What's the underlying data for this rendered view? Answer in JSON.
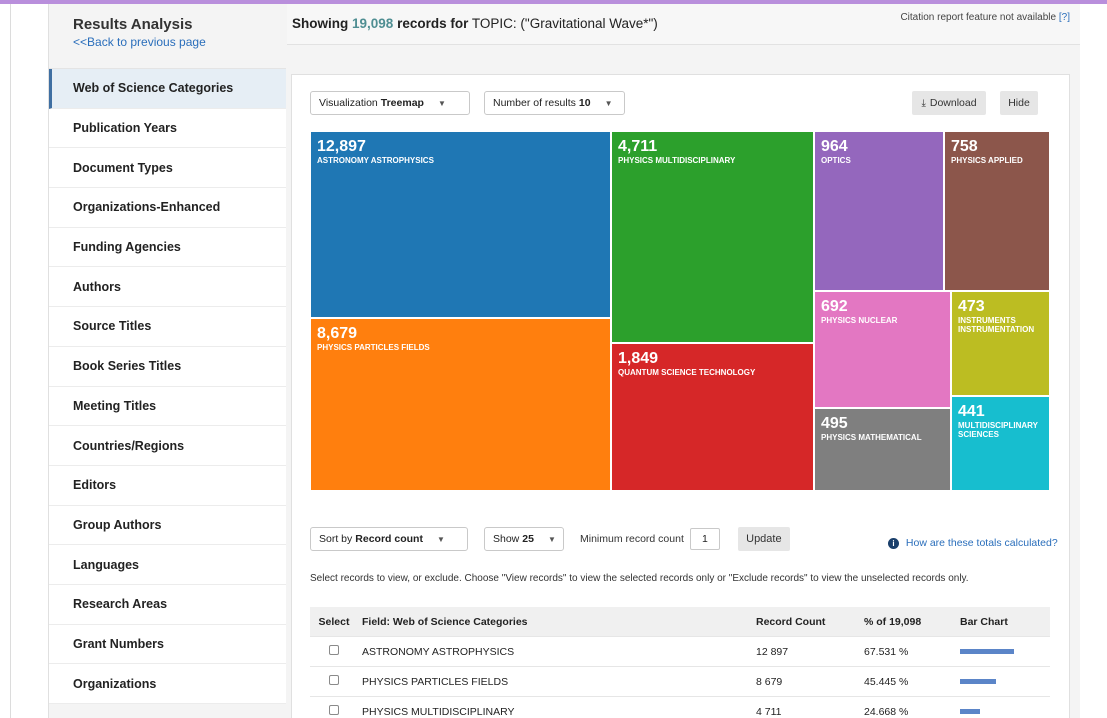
{
  "sidebar": {
    "title": "Results Analysis",
    "back_link": "<<Back to previous page",
    "items": [
      {
        "label": "Web of Science Categories",
        "active": true
      },
      {
        "label": "Publication Years"
      },
      {
        "label": "Document Types"
      },
      {
        "label": "Organizations-Enhanced"
      },
      {
        "label": "Funding Agencies"
      },
      {
        "label": "Authors"
      },
      {
        "label": "Source Titles"
      },
      {
        "label": "Book Series Titles"
      },
      {
        "label": "Meeting Titles"
      },
      {
        "label": "Countries/Regions"
      },
      {
        "label": "Editors"
      },
      {
        "label": "Group Authors"
      },
      {
        "label": "Languages"
      },
      {
        "label": "Research Areas"
      },
      {
        "label": "Grant Numbers"
      },
      {
        "label": "Organizations"
      }
    ]
  },
  "header": {
    "showing_prefix": "Showing",
    "count": "19,098",
    "records_for": "records for",
    "topic_label": "TOPIC:",
    "query": "(\"Gravitational Wave*\")",
    "citation_note": "Citation report feature not available",
    "citation_help": "[?]"
  },
  "controls": {
    "viz_label": "Visualization",
    "viz_value": "Treemap",
    "results_label": "Number of results",
    "results_value": "10",
    "download_label": "Download",
    "hide_label": "Hide"
  },
  "treemap": [
    {
      "count": "12,897",
      "label": "ASTRONOMY ASTROPHYSICS",
      "color": "#1f77b4"
    },
    {
      "count": "8,679",
      "label": "PHYSICS PARTICLES FIELDS",
      "color": "#ff7f0e"
    },
    {
      "count": "4,711",
      "label": "PHYSICS MULTIDISCIPLINARY",
      "color": "#2ca02c"
    },
    {
      "count": "1,849",
      "label": "QUANTUM SCIENCE TECHNOLOGY",
      "color": "#d62728"
    },
    {
      "count": "964",
      "label": "OPTICS",
      "color": "#9467bd"
    },
    {
      "count": "758",
      "label": "PHYSICS APPLIED",
      "color": "#8c564b"
    },
    {
      "count": "692",
      "label": "PHYSICS NUCLEAR",
      "color": "#e377c2"
    },
    {
      "count": "473",
      "label": "INSTRUMENTS INSTRUMENTATION",
      "color": "#bcbd22"
    },
    {
      "count": "495",
      "label": "PHYSICS MATHEMATICAL",
      "color": "#7f7f7f"
    },
    {
      "count": "441",
      "label": "MULTIDISCIPLINARY SCIENCES",
      "color": "#17becf"
    }
  ],
  "controls2": {
    "sort_label": "Sort by",
    "sort_value": "Record count",
    "show_label": "Show",
    "show_value": "25",
    "min_label": "Minimum record count",
    "min_value": "1",
    "update_label": "Update",
    "how_link": "How are these totals calculated?"
  },
  "instructions": "Select records to view, or exclude. Choose \"View records\" to view the selected records only or \"Exclude records\" to view the unselected records only.",
  "table": {
    "headers": {
      "select": "Select",
      "field": "Field: Web of Science Categories",
      "count": "Record Count",
      "pct": "% of 19,098",
      "bar": "Bar Chart"
    },
    "rows": [
      {
        "field": "ASTRONOMY ASTROPHYSICS",
        "count": "12 897",
        "pct": "67.531 %",
        "share": 0.67531
      },
      {
        "field": "PHYSICS PARTICLES FIELDS",
        "count": "8 679",
        "pct": "45.445 %",
        "share": 0.45445
      },
      {
        "field": "PHYSICS MULTIDISCIPLINARY",
        "count": "4 711",
        "pct": "24.668 %",
        "share": 0.24668
      }
    ]
  }
}
